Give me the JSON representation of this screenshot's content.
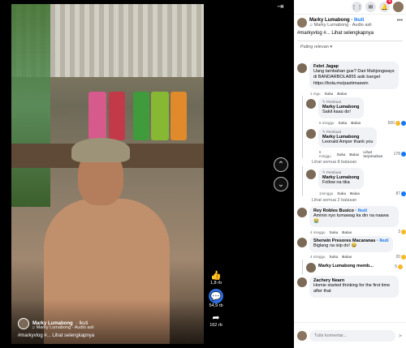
{
  "video": {
    "owner": "Marky Lumabong",
    "follow": "Ikuti",
    "audio": "Marky Lumabong · Audio asli",
    "caption": "#markyvlog #... Lihat selengkapnya",
    "actions": [
      {
        "icon": "like-icon",
        "count": "1,8 rb"
      },
      {
        "icon": "comment-icon",
        "count": "54,9 rb"
      },
      {
        "icon": "share-icon",
        "count": "162 rb"
      }
    ]
  },
  "topbar": {
    "notification_badge": "4"
  },
  "post": {
    "owner": "Marky Lumabong",
    "follow": "Ikuti",
    "audio": "Marky Lumabong · Audio asli",
    "caption": "#markyvlog #... Lihat selengkapnya"
  },
  "sort_label": "Paling relevan",
  "comments": [
    {
      "author": "Febri Jagap",
      "text": "Uang tambahan gue? Dari Mahjongways di BANDARBOLA855 asik banget https://bola.ms/pastimaswin",
      "meta": [
        "1 mgu",
        "Suka",
        "Balas"
      ]
    },
    {
      "pinned": "Pembuat",
      "author": "Marky Lumabong",
      "text": "Sakit kaau do!",
      "meta": [
        "6 minggu",
        "Suka",
        "Balas"
      ],
      "reactions": "500"
    },
    {
      "pinned": "Pembuat",
      "author": "Marky Lumabong",
      "text": "Leonald Amper thank you",
      "meta": [
        "6 minggu",
        "Suka",
        "Balas",
        "Lihat terjemahan"
      ],
      "reactions": "178",
      "more": "Lihat semua 8 balasan"
    },
    {
      "pinned": "Pembuat",
      "author": "Marky Lumabong",
      "text": "Follow na tika",
      "meta": [
        "1minggu",
        "Suka",
        "Balas"
      ],
      "reactions": "87",
      "more": "Lihat semua 2 balasan"
    },
    {
      "author": "Rey Robles Busico",
      "tag": "Ikuti",
      "text": "Aminin nyo tumawag ka din na naawa 😭",
      "meta": [
        "4 minggu",
        "Suka",
        "Balas"
      ],
      "reactions": "3"
    },
    {
      "author": "Sherwin Presores Macaranas",
      "tag": "Ikuti",
      "text": "Biglang na isip do! 😂",
      "meta": [
        "4 minggu",
        "Suka",
        "Balas"
      ],
      "reactions": "20"
    },
    {
      "author": "Marky Lumabong memb...",
      "text": "",
      "meta": [],
      "reactions": "5"
    },
    {
      "author": "Zachery Nearn",
      "text": "Homie started thinking for the first time after that",
      "meta": []
    }
  ],
  "input": {
    "placeholder": "Tulis komentar..."
  }
}
